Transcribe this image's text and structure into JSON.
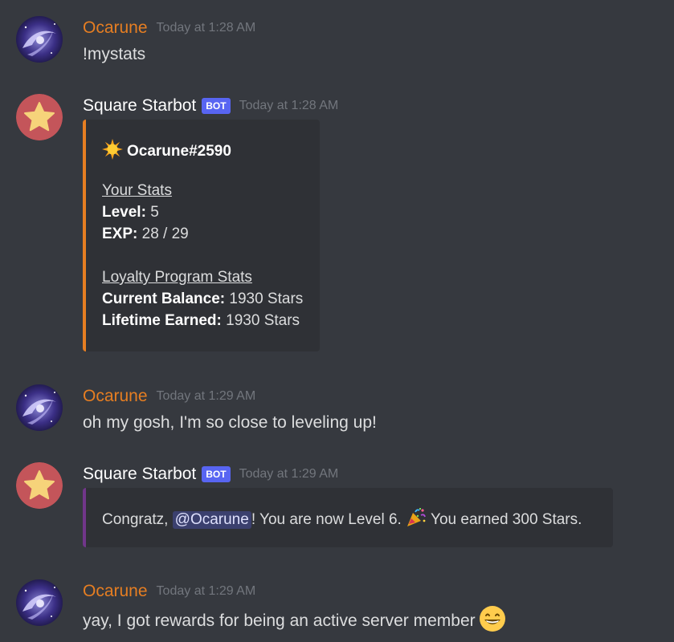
{
  "messages": [
    {
      "author": "Ocarune",
      "timestamp": "Today at 1:28 AM",
      "text": "!mystats"
    },
    {
      "author": "Square Starbot",
      "bot_tag": "BOT",
      "timestamp": "Today at 1:28 AM",
      "embed": {
        "accent_color": "#e67e22",
        "title_icon": "sun-emoji",
        "title": "Ocarune#2590",
        "section1_heading": "Your Stats",
        "level_label": "Level:",
        "level_value": " 5",
        "exp_label": "EXP:",
        "exp_value": " 28 / 29",
        "section2_heading": "Loyalty Program Stats",
        "balance_label": "Current Balance:",
        "balance_value": " 1930 Stars",
        "lifetime_label": "Lifetime Earned:",
        "lifetime_value": " 1930 Stars"
      }
    },
    {
      "author": "Ocarune",
      "timestamp": "Today at 1:29 AM",
      "text": "oh my gosh, I'm so close to leveling up!"
    },
    {
      "author": "Square Starbot",
      "bot_tag": "BOT",
      "timestamp": "Today at 1:29 AM",
      "embed": {
        "accent_color": "#71368a",
        "text_before": "Congratz, ",
        "mention": "@Ocarune",
        "text_middle": "! You are now Level 6. ",
        "emoji": "party-popper-emoji",
        "text_after": " You earned 300 Stars."
      }
    },
    {
      "author": "Ocarune",
      "timestamp": "Today at 1:29 AM",
      "text": "yay, I got rewards for being an active server member",
      "trailing_emoji": "grinning-face-emoji"
    }
  ],
  "colors": {
    "background": "#36393f",
    "embed_background": "#2f3136",
    "user_name": "#e67e22",
    "bot_tag": "#5865f2",
    "timestamp": "#72767d",
    "text": "#dcddde"
  }
}
